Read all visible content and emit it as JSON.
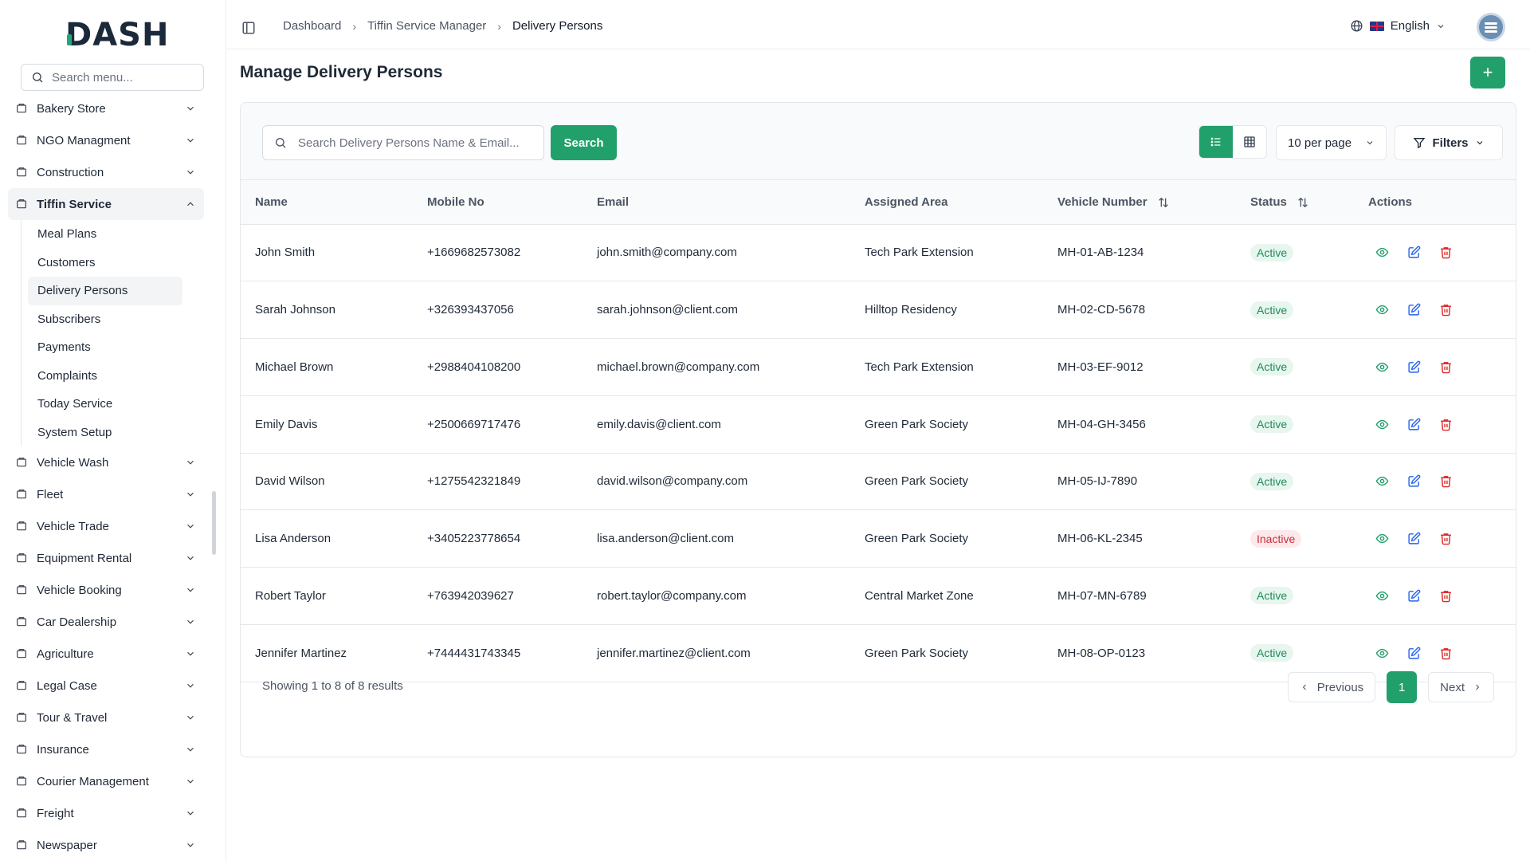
{
  "brand": {
    "logo": "DASH",
    "accent": "#22a06b"
  },
  "sidebar": {
    "search_placeholder": "Search menu...",
    "items_top": [
      {
        "label": "Bakery Store",
        "icon": "store-icon"
      },
      {
        "label": "NGO Managment",
        "icon": "handshake-icon"
      },
      {
        "label": "Construction",
        "icon": "crane-icon"
      }
    ],
    "active_group": {
      "label": "Tiffin Service",
      "icon": "tiffin-icon",
      "children": [
        "Meal Plans",
        "Customers",
        "Delivery Persons",
        "Subscribers",
        "Payments",
        "Complaints",
        "Today Service",
        "System Setup"
      ],
      "active_child": "Delivery Persons"
    },
    "items_bottom": [
      {
        "label": "Vehicle Wash",
        "icon": "car-wash-icon"
      },
      {
        "label": "Fleet",
        "icon": "fleet-icon"
      },
      {
        "label": "Vehicle Trade",
        "icon": "bike-icon"
      },
      {
        "label": "Equipment Rental",
        "icon": "wrench-icon"
      },
      {
        "label": "Vehicle Booking",
        "icon": "booking-icon"
      },
      {
        "label": "Car Dealership",
        "icon": "car-icon"
      },
      {
        "label": "Agriculture",
        "icon": "tractor-icon"
      },
      {
        "label": "Legal Case",
        "icon": "scale-icon"
      },
      {
        "label": "Tour & Travel",
        "icon": "plane-icon"
      },
      {
        "label": "Insurance",
        "icon": "shield-icon"
      },
      {
        "label": "Courier Management",
        "icon": "truck-icon"
      },
      {
        "label": "Freight",
        "icon": "container-icon"
      },
      {
        "label": "Newspaper",
        "icon": "newspaper-icon"
      }
    ]
  },
  "header": {
    "breadcrumb": [
      "Dashboard",
      "Tiffin Service Manager",
      "Delivery Persons"
    ],
    "language": "English"
  },
  "page": {
    "title": "Manage Delivery Persons",
    "add_label": "+"
  },
  "toolbar": {
    "search_placeholder": "Search Delivery Persons Name & Email...",
    "search_button": "Search",
    "per_page": "10 per page",
    "filters": "Filters"
  },
  "table": {
    "columns": [
      "Name",
      "Mobile No",
      "Email",
      "Assigned Area",
      "Vehicle Number",
      "Status",
      "Actions"
    ],
    "rows": [
      {
        "name": "John Smith",
        "mobile": "+1669682573082",
        "email": "john.smith@company.com",
        "area": "Tech Park Extension",
        "vehicle": "MH-01-AB-1234",
        "status": "Active"
      },
      {
        "name": "Sarah Johnson",
        "mobile": "+326393437056",
        "email": "sarah.johnson@client.com",
        "area": "Hilltop Residency",
        "vehicle": "MH-02-CD-5678",
        "status": "Active"
      },
      {
        "name": "Michael Brown",
        "mobile": "+2988404108200",
        "email": "michael.brown@company.com",
        "area": "Tech Park Extension",
        "vehicle": "MH-03-EF-9012",
        "status": "Active"
      },
      {
        "name": "Emily Davis",
        "mobile": "+2500669717476",
        "email": "emily.davis@client.com",
        "area": "Green Park Society",
        "vehicle": "MH-04-GH-3456",
        "status": "Active"
      },
      {
        "name": "David Wilson",
        "mobile": "+1275542321849",
        "email": "david.wilson@company.com",
        "area": "Green Park Society",
        "vehicle": "MH-05-IJ-7890",
        "status": "Active"
      },
      {
        "name": "Lisa Anderson",
        "mobile": "+3405223778654",
        "email": "lisa.anderson@client.com",
        "area": "Green Park Society",
        "vehicle": "MH-06-KL-2345",
        "status": "Inactive"
      },
      {
        "name": "Robert Taylor",
        "mobile": "+763942039627",
        "email": "robert.taylor@company.com",
        "area": "Central Market Zone",
        "vehicle": "MH-07-MN-6789",
        "status": "Active"
      },
      {
        "name": "Jennifer Martinez",
        "mobile": "+7444431743345",
        "email": "jennifer.martinez@client.com",
        "area": "Green Park Society",
        "vehicle": "MH-08-OP-0123",
        "status": "Active"
      }
    ]
  },
  "pagination": {
    "summary": "Showing 1 to 8 of 8 results",
    "previous": "Previous",
    "current_page": "1",
    "next": "Next"
  }
}
